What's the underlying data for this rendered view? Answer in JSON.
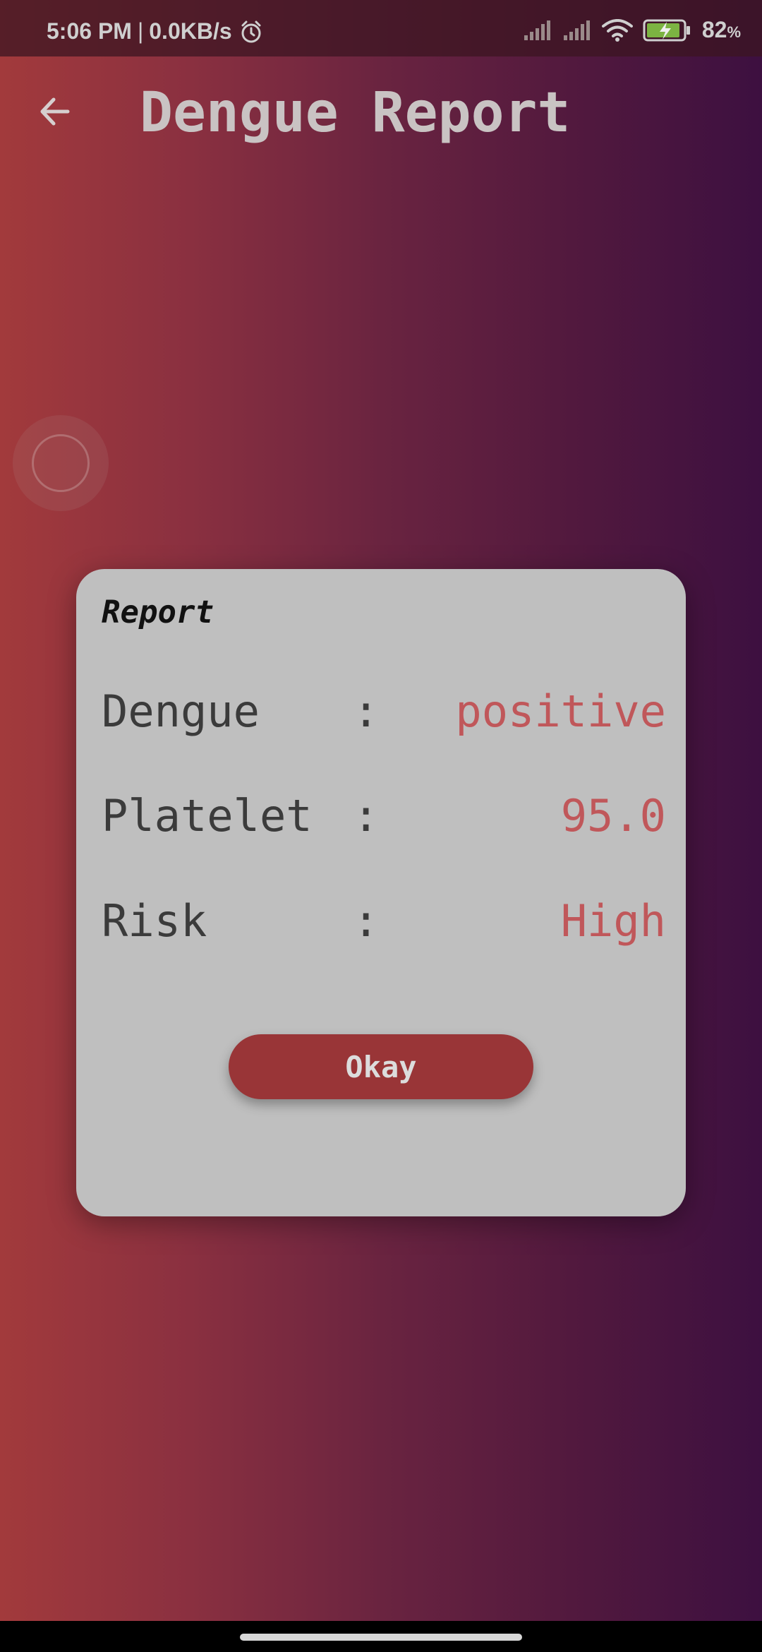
{
  "status_bar": {
    "time": "5:06 PM",
    "separator": "|",
    "network_speed": "0.0KB/s",
    "battery_percent": "82",
    "battery_unit": "%",
    "icons": [
      "alarm-icon",
      "signal-icon",
      "signal-icon",
      "wifi-icon",
      "battery-charging-icon"
    ]
  },
  "app_bar": {
    "title": "Dengue Report",
    "back_icon": "arrow-back-icon"
  },
  "dialog": {
    "title": "Report",
    "rows": [
      {
        "label": "Dengue",
        "colon": ":",
        "value": "positive"
      },
      {
        "label": "Platelet",
        "colon": ":",
        "value": "95.0"
      },
      {
        "label": "Risk",
        "colon": ":",
        "value": "High"
      }
    ],
    "button_label": "Okay"
  },
  "colors": {
    "gradient_start": "#a23a3c",
    "gradient_end": "#3d1040",
    "dialog_background": "#bfbfbf",
    "value_text": "#c0575a",
    "button_background": "#993537"
  }
}
